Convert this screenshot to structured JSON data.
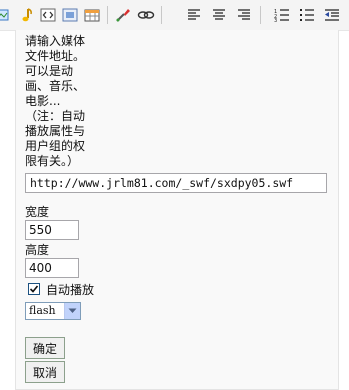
{
  "toolbar": {
    "icons": [
      "smiley-icon",
      "music-note-icon",
      "html-source-icon",
      "media-icon",
      "table-icon",
      "paint-icon",
      "link-icon",
      "align-left-icon",
      "align-center-icon",
      "align-right-icon",
      "ordered-list-icon",
      "unordered-list-icon",
      "outdent-icon"
    ]
  },
  "dialog": {
    "instructions": "请输入媒体\n文件地址。\n可以是动\n画、音乐、\n电影...\n（注：自动\n播放属性与\n用户组的权\n限有关。）",
    "url_value": "http://www.jrlm81.com/_swf/sxdpy05.swf",
    "width_label": "宽度",
    "width_value": "550",
    "height_label": "高度",
    "height_value": "400",
    "autoplay_label": "自动播放",
    "autoplay_checked": true,
    "format_selected": "flash",
    "confirm_label": "确定",
    "cancel_label": "取消"
  },
  "colors": {
    "toolbar_bg": "#f4f4f4",
    "panel_bg": "#f9f9f9",
    "button_border": "#8ca08c"
  }
}
